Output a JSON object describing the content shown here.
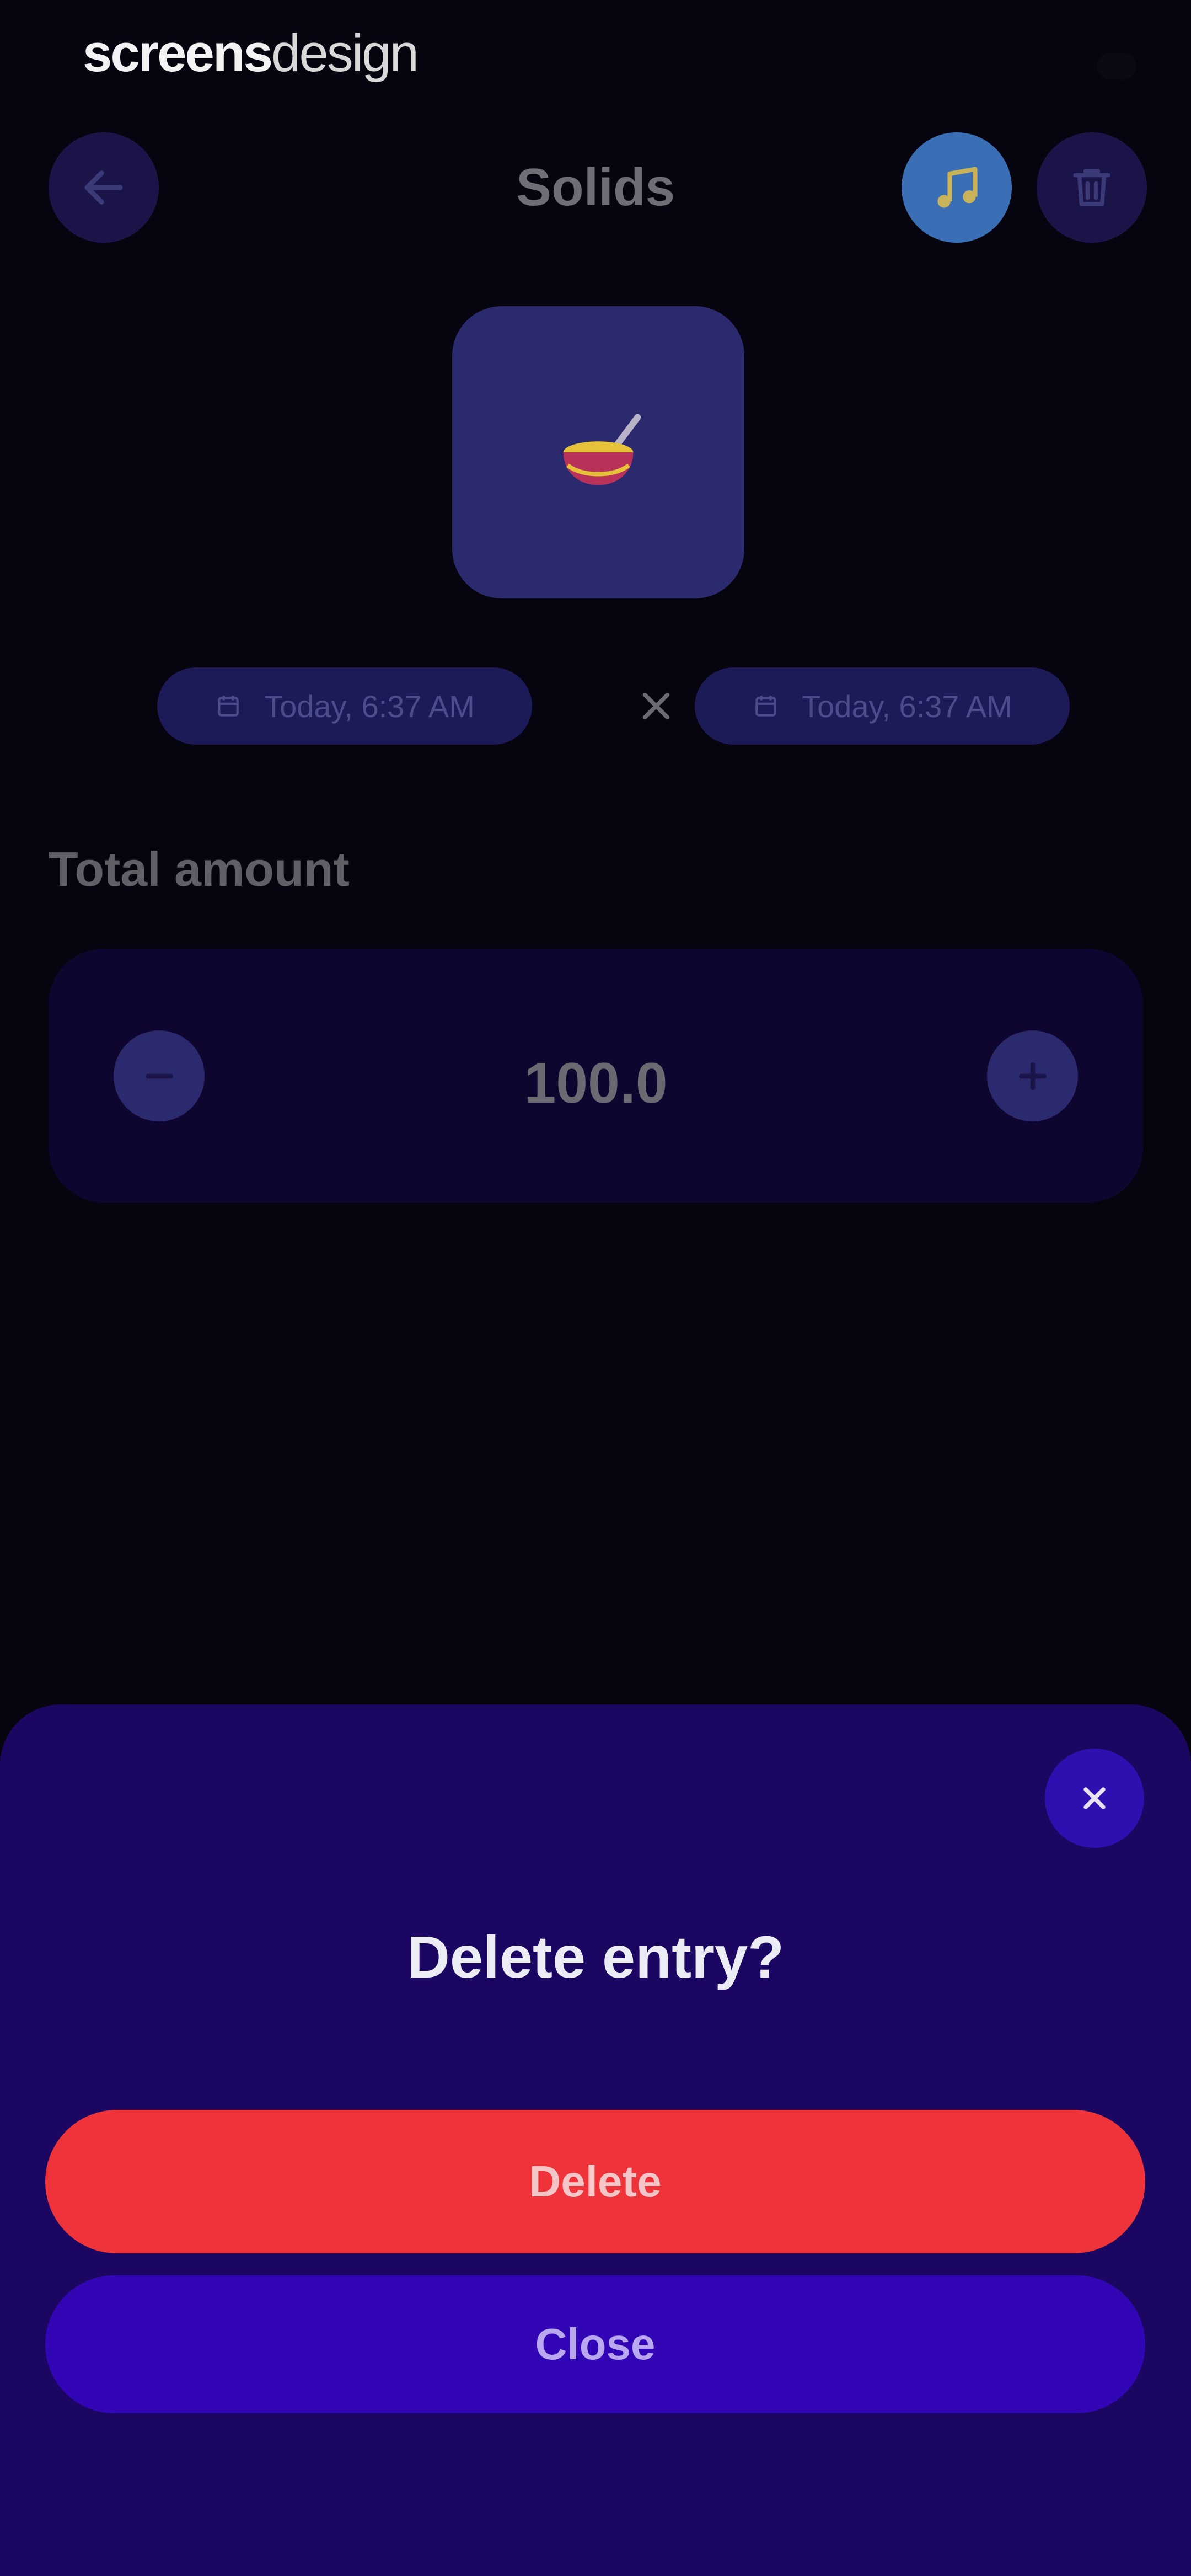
{
  "watermark": {
    "bold": "screens",
    "thin": "design"
  },
  "header": {
    "title": "Solids",
    "back_icon": "arrow-left-icon",
    "music_icon": "music-note-icon",
    "delete_icon": "trash-icon"
  },
  "entry": {
    "icon": "bowl-icon",
    "start_time": "Today, 6:37 AM",
    "end_time": "Today, 6:37 AM",
    "clear_icon": "close-icon"
  },
  "amount": {
    "label": "Total amount",
    "value": "100.0",
    "minus_icon": "minus-icon",
    "plus_icon": "plus-icon"
  },
  "dialog": {
    "title": "Delete entry?",
    "delete_label": "Delete",
    "close_label": "Close",
    "close_icon": "close-icon"
  },
  "colors": {
    "background": "#05040f",
    "sheet": "#1b0762",
    "danger": "#ef333a",
    "primary": "#3206b4",
    "accent_blue": "#3a6fb6"
  }
}
